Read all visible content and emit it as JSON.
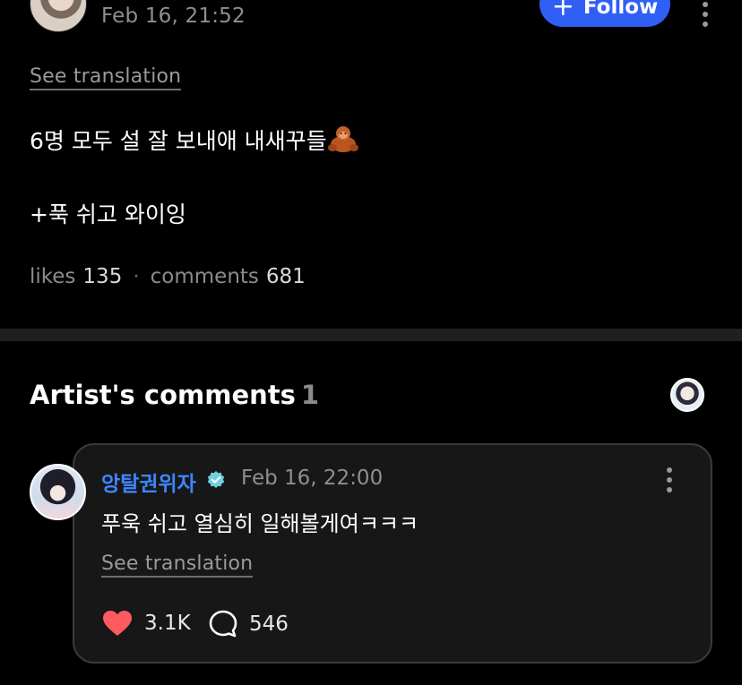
{
  "post": {
    "date": "Feb 16, 21:52",
    "follow_label": "Follow",
    "see_translation": "See translation",
    "text_line1": "6명 모두 설 잘 보내애 내새꾸들",
    "text_line2": "+푹 쉬고 와이잉",
    "emoji": "orangutan-icon",
    "likes_label": "likes",
    "likes_count": "135",
    "separator": "·",
    "comments_label": "comments",
    "comments_count": "681"
  },
  "artist_comments": {
    "title": "Artist's comments",
    "count": "1",
    "comment": {
      "author": "앙탈권위자",
      "verified": true,
      "date": "Feb 16, 22:00",
      "text": "푸욱 쉬고 열심히 일해볼게여ㅋㅋㅋ",
      "see_translation": "See translation",
      "likes": "3.1K",
      "replies": "546"
    }
  },
  "colors": {
    "background": "#000000",
    "follow_button": "#2f5ff5",
    "author_name": "#3c86ff",
    "verified_badge": "#6fd0de",
    "heart": "#ff5a5f",
    "card_background": "#171717",
    "divider": "#1f1f1f"
  },
  "icons": [
    "plus-icon",
    "more-vertical-icon",
    "orangutan-icon",
    "verified-badge-icon",
    "heart-icon",
    "comment-bubble-icon"
  ]
}
